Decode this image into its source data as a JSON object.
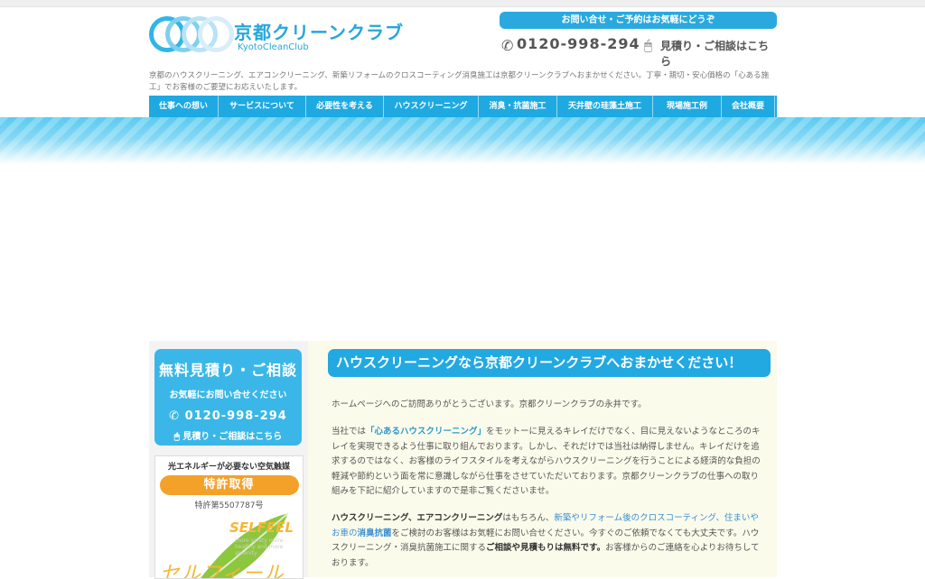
{
  "brand": {
    "name_jp": "京都クリーンクラブ",
    "name_en": "KyotoCleanClub",
    "logo_icon": "kyoto-clean-club-logo"
  },
  "header": {
    "contact_pill": "お問い合せ・ご予約はお気軽にどうぞ",
    "phone": "0120-998-294",
    "estimate_link": "見積り・ご相談はこちら",
    "icons": {
      "phone": "phone-icon",
      "estimate": "mouse-icon"
    }
  },
  "intro": "京都のハウスクリーニング、エアコンクリーニング、新築リフォームのクロスコーティング消臭施工は京都クリーンクラブへおまかせください。丁寧・親切・安心価格の「心ある施工」でお客様のご要望にお応えいたします。",
  "nav": {
    "items": [
      {
        "label": "仕事への想い"
      },
      {
        "label": "サービスについて"
      },
      {
        "label": "必要性を考える"
      },
      {
        "label": "ハウスクリーニング"
      },
      {
        "label": "消臭・抗菌施工"
      },
      {
        "label": "天井壁の珪藻土施工"
      },
      {
        "label": "現場施工例"
      },
      {
        "label": "会社概要"
      }
    ]
  },
  "sidebar": {
    "card1": {
      "title": "無料見積り・ご相談",
      "sub": "お気軽にお問い合せください",
      "phone": "0120-998-294",
      "link": "見積り・ご相談はこちら"
    },
    "card2": {
      "top": "光エネルギーが必要ない空気触媒",
      "pill": "特許取得",
      "patent": "特許第5507787号",
      "selfeel": "SELFEEL",
      "selfeel_small": "more safety more healthy and more amenity",
      "katakana": "セルフィール"
    }
  },
  "main": {
    "heading": "ハウスクリーニングなら京都クリーンクラブへおまかせください！",
    "p1": "ホームページへのご訪問ありがとうございます。京都クリーンクラブの永井です。",
    "p2a": "当社では",
    "p2b": "「心あるハウスクリーニング」",
    "p2c": "をモットーに見えるキレイだけでなく、目に見えないようなところのキレイを実現できるよう仕事に取り組んでおります。しかし、それだけでは当社は納得しません。キレイだけを追求するのではなく、お客様のライフスタイルを考えながらハウスクリーニングを行うことによる経済的な負担の軽減や節約という面を常に意識しながら仕事をさせていただいております。京都クリーンクラブの仕事への取り組みを下記に紹介していますので是非ご覧くださいませ。",
    "p3a": "ハウスクリーニング、エアコンクリーニング",
    "p3b": "はもちろん、",
    "p3c": "新築やリフォーム後のクロスコーティング、住まいやお車の",
    "p3d": "消臭抗菌",
    "p3e": "をご検討のお客様はお気軽にお問い合せください。今すぐのご依頼でなくても大丈夫です。ハウスクリーニング・消臭抗菌施工に関する",
    "p3f": "ご相談や見積もりは無料です。",
    "p3g": "お客様からのご連絡を心よりお待ちしております。"
  },
  "colors": {
    "accent": "#1fa9e1",
    "orange": "#f4a12a",
    "content_bg": "#fbfbeb"
  }
}
